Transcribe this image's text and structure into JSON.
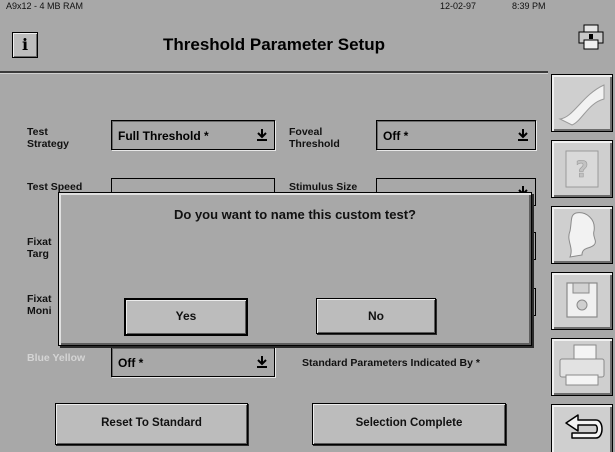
{
  "status": {
    "memory": "A9x12 - 4 MB RAM",
    "date": "12-02-97",
    "time": "8:39 PM"
  },
  "header": {
    "title": "Threshold Parameter Setup",
    "info_icon_glyph": "i"
  },
  "form": {
    "test_strategy": {
      "label": "Test\nStrategy",
      "value": "Full Threshold *"
    },
    "foveal_threshold": {
      "label": "Foveal\nThreshold",
      "value": "Off *"
    },
    "test_speed": {
      "label": "Test Speed"
    },
    "stimulus_size": {
      "label": "Stimulus Size"
    },
    "fixation_target": {
      "label": "Fixat\nTarg"
    },
    "fixation_monitor": {
      "label": "Fixat\nMoni"
    },
    "blue_yellow": {
      "label": "Blue Yellow",
      "value": "Off *"
    },
    "standard_note": "Standard Parameters Indicated By *"
  },
  "buttons": {
    "reset": "Reset To Standard",
    "complete": "Selection Complete"
  },
  "dialog": {
    "message": "Do you want to name this custom test?",
    "yes": "Yes",
    "no": "No"
  },
  "sidebar": [
    {
      "icon": "curve-icon"
    },
    {
      "icon": "help-question-icon"
    },
    {
      "icon": "patient-profile-icon"
    },
    {
      "icon": "floppy-disk-icon"
    },
    {
      "icon": "printer-paper-icon"
    },
    {
      "icon": "return-arrow-icon"
    }
  ],
  "colors": {
    "background": "#a8a8a8",
    "dialog": "#a8a8a8",
    "disabled_label": "#d4d4d4"
  }
}
